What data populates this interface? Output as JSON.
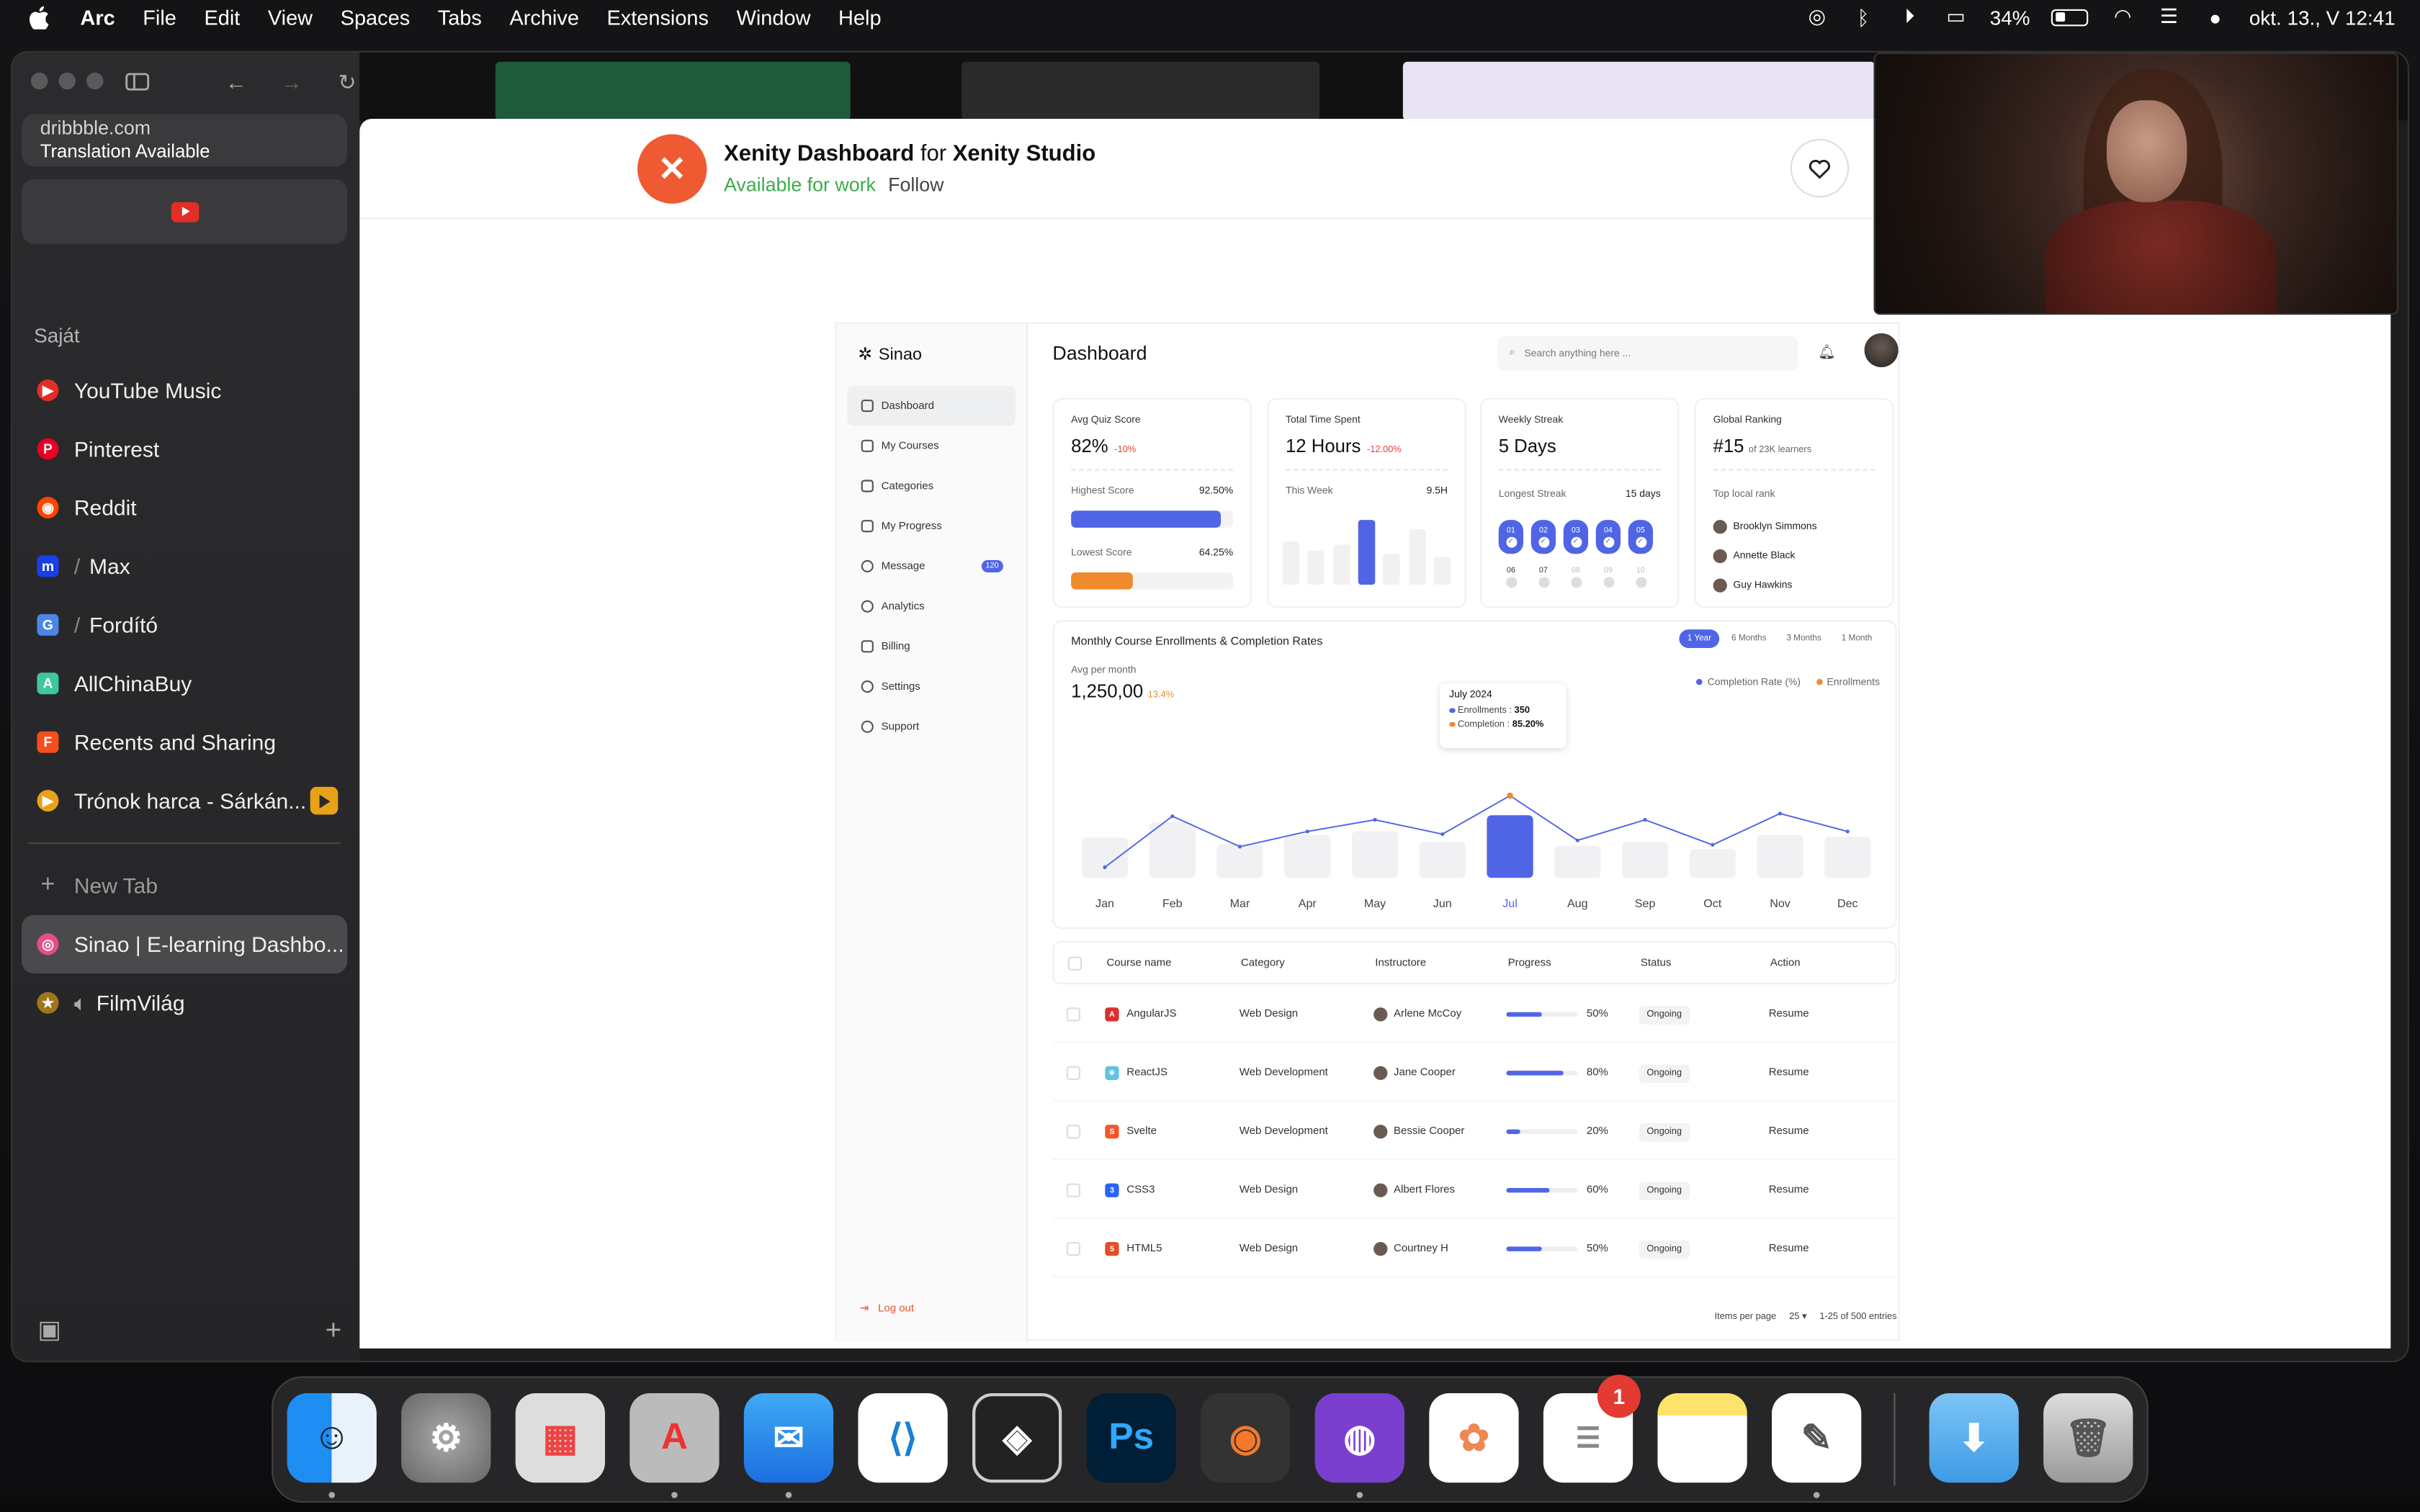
{
  "menubar": {
    "app": "Arc",
    "items": [
      "File",
      "Edit",
      "View",
      "Spaces",
      "Tabs",
      "Archive",
      "Extensions",
      "Window",
      "Help"
    ],
    "battery": "34%",
    "datetime": "okt. 13., V  12:41"
  },
  "sidebar": {
    "url": "dribbble.com",
    "translation": "Translation Available",
    "section_title": "Saját",
    "tabs": [
      {
        "label": "YouTube Music",
        "color": "#e52d27"
      },
      {
        "label": "Pinterest",
        "color": "#e60023"
      },
      {
        "label": "Reddit",
        "color": "#ff4500"
      },
      {
        "label": "Max",
        "color": "#1a3ee8",
        "prefix": "/"
      },
      {
        "label": "Fordító",
        "color": "#4a86e8",
        "prefix": "/"
      },
      {
        "label": "AllChinaBuy",
        "color": "#3ec7a0"
      },
      {
        "label": "Recents and Sharing",
        "color": "#f24e1e"
      },
      {
        "label": "Trónok harca - Sárkán...",
        "color": "#e8a21a"
      }
    ],
    "new_tab": "New Tab",
    "active_tab": "Sinao | E-learning Dashbo...",
    "last_tab": "FilmVilág"
  },
  "shot": {
    "title": "Xenity Dashboard",
    "for": "for",
    "studio": "Xenity Studio",
    "available": "Available for work",
    "follow": "Follow"
  },
  "dash": {
    "logo": "Sinao",
    "nav": [
      "Dashboard",
      "My Courses",
      "Categories",
      "My Progress",
      "Message",
      "Analytics",
      "Billing",
      "Settings",
      "Support"
    ],
    "message_badge": "120",
    "logout": "Log out",
    "title": "Dashboard",
    "search_placeholder": "Search anything here ...",
    "quiz": {
      "label": "Avg Quiz Score",
      "value": "82%",
      "delta": "-10%",
      "high_label": "Highest Score",
      "high": "92.50%",
      "high_frac": 0.925,
      "low_label": "Lowest Score",
      "low": "64.25%",
      "low_frac": 0.6425
    },
    "time": {
      "label": "Total Time Spent",
      "value": "12 Hours",
      "delta": "-12.00%",
      "week_label": "This Week",
      "week_value": "9.5H"
    },
    "streak": {
      "label": "Weekly Streak",
      "value": "5 Days",
      "longest_label": "Longest Streak",
      "longest": "15 days",
      "days1": [
        "01",
        "02",
        "03",
        "04",
        "05"
      ],
      "days2": [
        "06",
        "07",
        "08",
        "09",
        "10"
      ]
    },
    "ranking": {
      "label": "Global Ranking",
      "value": "#15",
      "sub": "of 23K learners",
      "local_label": "Top local rank",
      "names": [
        "Brooklyn Simmons",
        "Annette Black",
        "Guy Hawkins"
      ]
    },
    "chart": {
      "title": "Monthly Course Enrollments & Completion Rates",
      "tabs": [
        "1 Year",
        "6 Months",
        "3 Months",
        "1 Month"
      ],
      "avg_label": "Avg per month",
      "avg_value": "1,250,00",
      "avg_delta": "13.4%",
      "legend": [
        "Completion Rate (%)",
        "Enrollments"
      ],
      "tooltip_title": "July 2024",
      "tooltip_enroll_label": "Enrollments :",
      "tooltip_enroll": "350",
      "tooltip_comp_label": "Completion :",
      "tooltip_comp": "85.20%"
    },
    "table": {
      "headers": [
        "Course name",
        "Category",
        "Instructore",
        "Progress",
        "Status",
        "Action"
      ],
      "rows": [
        {
          "course": "AngularJS",
          "category": "Web Design",
          "instructor": "Arlene McCoy",
          "progress": "50%",
          "pct": 0.5,
          "status": "Ongoing",
          "action": "Resume",
          "icolor": "#dd2f2f",
          "iglyph": "A"
        },
        {
          "course": "ReactJS",
          "category": "Web Development",
          "instructor": "Jane Cooper",
          "progress": "80%",
          "pct": 0.8,
          "status": "Ongoing",
          "action": "Resume",
          "icolor": "#61c3e0",
          "iglyph": "⚛"
        },
        {
          "course": "Svelte",
          "category": "Web Development",
          "instructor": "Bessie Cooper",
          "progress": "20%",
          "pct": 0.2,
          "status": "Ongoing",
          "action": "Resume",
          "icolor": "#f2562b",
          "iglyph": "S"
        },
        {
          "course": "CSS3",
          "category": "Web Design",
          "instructor": "Albert Flores",
          "progress": "60%",
          "pct": 0.6,
          "status": "Ongoing",
          "action": "Resume",
          "icolor": "#2965f1",
          "iglyph": "3"
        },
        {
          "course": "HTML5",
          "category": "Web Design",
          "instructor": "Courtney H",
          "progress": "50%",
          "pct": 0.5,
          "status": "Ongoing",
          "action": "Resume",
          "icolor": "#e44d26",
          "iglyph": "5"
        }
      ],
      "items_per_page_label": "Items per page",
      "items_per_page": "25",
      "entries": "1-25 of 500 entries"
    }
  },
  "chart_data": {
    "type": "bar",
    "categories": [
      "Jan",
      "Feb",
      "Mar",
      "Apr",
      "May",
      "Jun",
      "Jul",
      "Aug",
      "Sep",
      "Oct",
      "Nov",
      "Dec"
    ],
    "series": [
      {
        "name": "Enrollments",
        "values": [
          45,
          62,
          38,
          48,
          52,
          40,
          70,
          36,
          40,
          32,
          48,
          46
        ]
      },
      {
        "name": "Completion Rate (%)",
        "values": [
          5,
          62,
          28,
          45,
          58,
          42,
          85,
          35,
          58,
          30,
          65,
          45
        ]
      }
    ],
    "highlight": "Jul",
    "colors": {
      "bars": "#f1f1f3",
      "highlight": "#5065e6",
      "line": "#5065e6"
    }
  },
  "dock": {
    "apps": [
      "Finder",
      "System Settings",
      "Launchpad",
      "Affinity",
      "Mail",
      "VS Code",
      "DaVinci Resolve",
      "Photoshop",
      "Blender",
      "GitHub Desktop",
      "Photos",
      "Reminders",
      "Notes",
      "TextEdit",
      "Downloads",
      "Trash"
    ],
    "reminders_badge": "1"
  }
}
